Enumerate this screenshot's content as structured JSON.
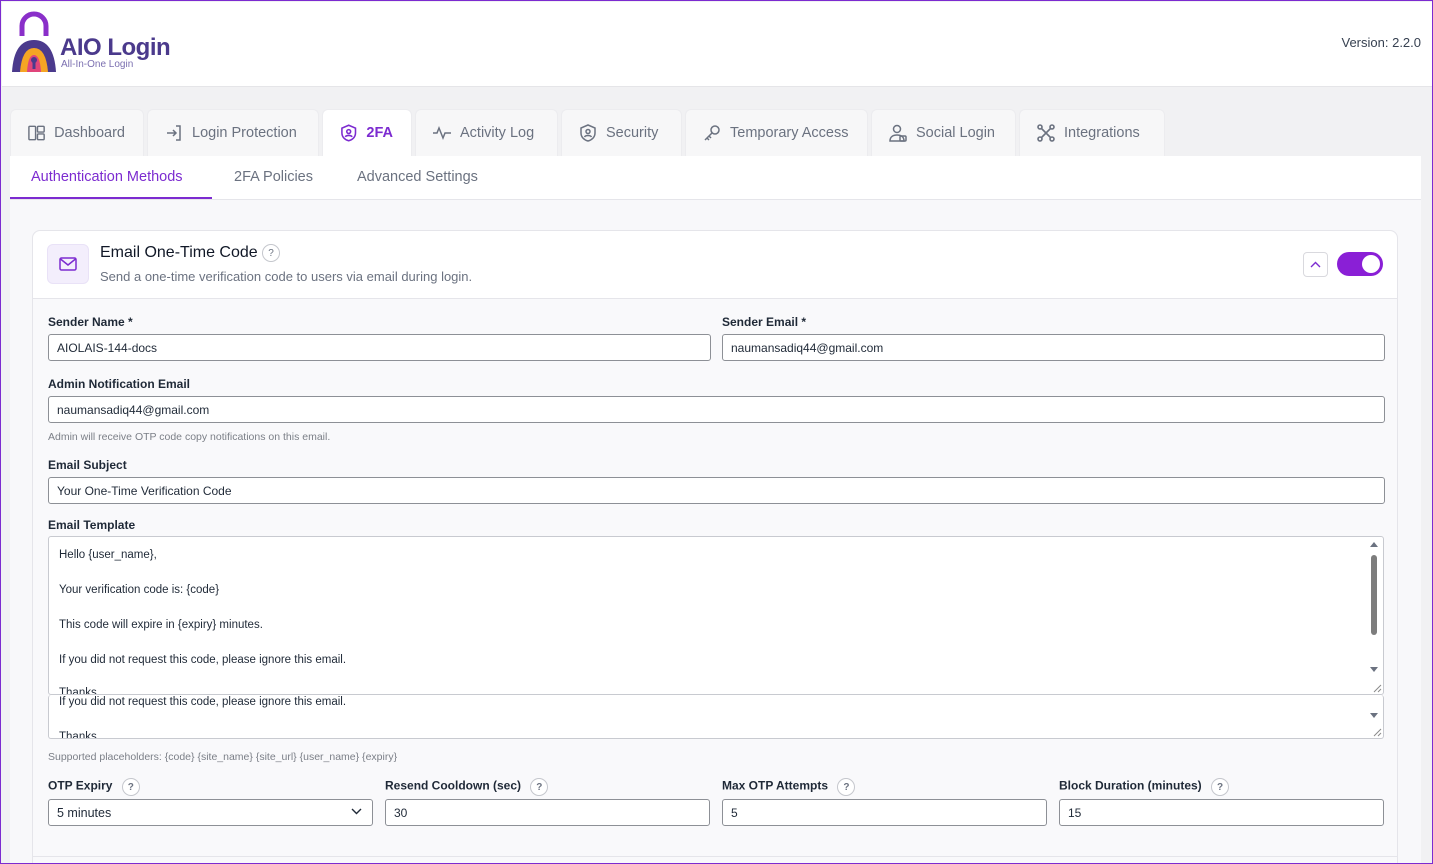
{
  "app": {
    "name": "AIO Login",
    "tagline": "All-In-One Login",
    "version": "Version: 2.2.0"
  },
  "colors": {
    "accent": "#7c2bd0",
    "brand": "#4b3a8c",
    "toggle_on": "#8a1fd6"
  },
  "main_tabs": [
    {
      "label": "Dashboard",
      "icon": "dashboard-icon"
    },
    {
      "label": "Login Protection",
      "icon": "login-icon"
    },
    {
      "label": "2FA",
      "icon": "shield-user-icon",
      "active": true
    },
    {
      "label": "Activity Log",
      "icon": "activity-icon"
    },
    {
      "label": "Security",
      "icon": "shield-icon"
    },
    {
      "label": "Temporary Access",
      "icon": "key-icon"
    },
    {
      "label": "Social Login",
      "icon": "users-icon"
    },
    {
      "label": "Integrations",
      "icon": "integrations-icon"
    }
  ],
  "sub_tabs": [
    {
      "label": "Authentication Methods",
      "active": true
    },
    {
      "label": "2FA Policies"
    },
    {
      "label": "Advanced Settings"
    }
  ],
  "card": {
    "title": "Email One-Time Code",
    "help": "?",
    "description": "Send a one-time verification code to users via email during login.",
    "enabled": true
  },
  "form": {
    "sender_name": {
      "label": "Sender Name *",
      "value": "AIOLAIS-144-docs"
    },
    "sender_email": {
      "label": "Sender Email *",
      "value": "naumansadiq44@gmail.com"
    },
    "admin_email": {
      "label": "Admin Notification Email",
      "value": "naumansadiq44@gmail.com",
      "hint": "Admin will receive OTP code copy notifications on this email."
    },
    "subject": {
      "label": "Email Subject",
      "value": "Your One-Time Verification Code"
    },
    "template": {
      "label": "Email Template",
      "lines": [
        "Hello {user_name},",
        "Your verification code is: {code}",
        "This code will expire in {expiry} minutes.",
        "If you did not request this code, please ignore this email.",
        "Thanks,"
      ],
      "overflow_lines": [
        "If you did not request this code, please ignore this email.",
        "Thanks,"
      ]
    },
    "placeholders_hint": "Supported placeholders: {code} {site_name} {site_url} {user_name} {expiry}",
    "otp_expiry": {
      "label": "OTP Expiry",
      "value": "5 minutes"
    },
    "resend_cooldown": {
      "label": "Resend Cooldown (sec)",
      "value": "30"
    },
    "max_attempts": {
      "label": "Max OTP Attempts",
      "value": "5"
    },
    "block_duration": {
      "label": "Block Duration (minutes)",
      "value": "15"
    }
  }
}
